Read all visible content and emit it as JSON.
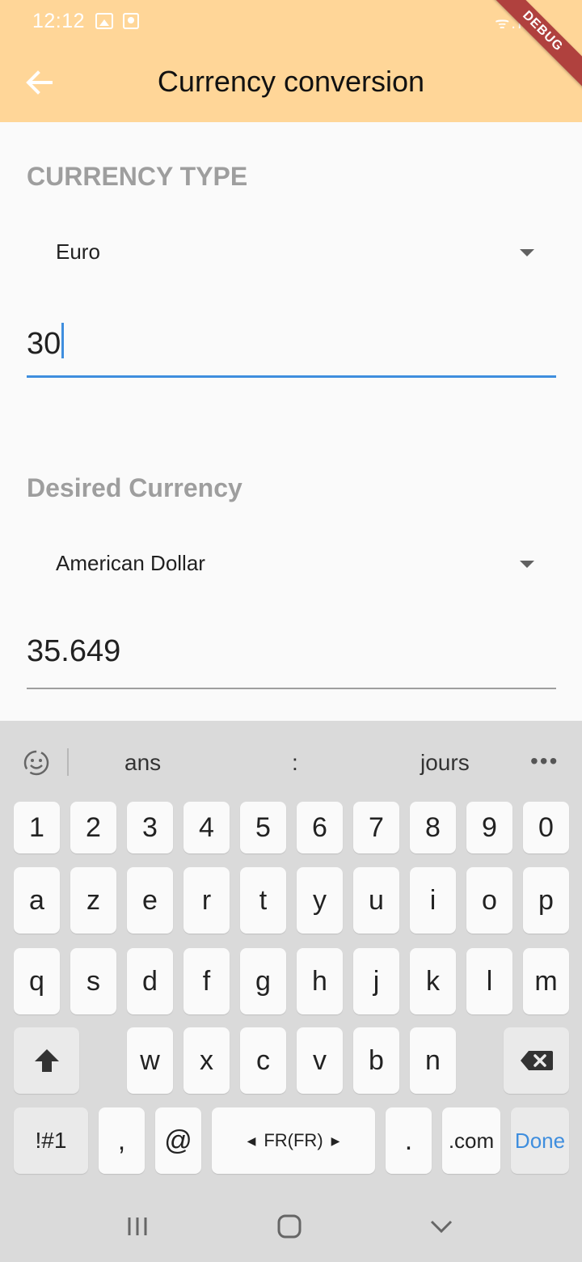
{
  "status_bar": {
    "time": "12:12",
    "right_indicators": "ᯤ.ıl"
  },
  "debug_banner": "DEBUG",
  "app_bar": {
    "title": "Currency conversion",
    "back_icon": "arrow-back-icon"
  },
  "currency_type": {
    "label": "CURRENCY TYPE",
    "selected": "Euro",
    "amount": "30"
  },
  "desired_currency": {
    "label": "Desired Currency",
    "selected": "American Dollar",
    "amount": "35.649"
  },
  "keyboard": {
    "suggestions": [
      "ans",
      ":",
      "jours"
    ],
    "more": "•••",
    "row_numbers": [
      "1",
      "2",
      "3",
      "4",
      "5",
      "6",
      "7",
      "8",
      "9",
      "0"
    ],
    "row_1": [
      "a",
      "z",
      "e",
      "r",
      "t",
      "y",
      "u",
      "i",
      "o",
      "p"
    ],
    "row_2": [
      "q",
      "s",
      "d",
      "f",
      "g",
      "h",
      "j",
      "k",
      "l",
      "m"
    ],
    "row_3": [
      "w",
      "x",
      "c",
      "v",
      "b",
      "n"
    ],
    "row_4": {
      "symbols": "!#1",
      "comma": ",",
      "at": "@",
      "space": "FR(FR)",
      "period": ".",
      "dotcom": ".com",
      "done": "Done"
    }
  },
  "colors": {
    "app_bar": "#ffd698",
    "accent": "#3f8ede",
    "debug": "#b0413e",
    "label": "#9e9e9e"
  }
}
